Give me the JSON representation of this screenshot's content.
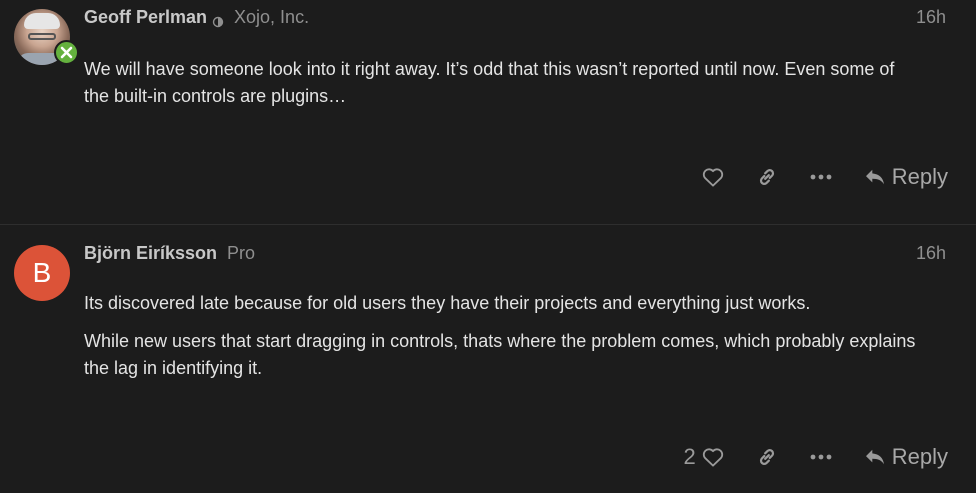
{
  "posts": [
    {
      "username": "Geoff Perlman",
      "user_title": "Xojo, Inc.",
      "timestamp": "16h",
      "avatar": {
        "type": "photo",
        "badge_icon": "xojo-x-icon",
        "badge_color": "#64b13e"
      },
      "paragraphs": [
        "We will have someone look into it right away. It’s odd that this wasn’t reported until now. Even some of the built-in controls are plugins…"
      ],
      "like_count": "",
      "reply_label": "Reply"
    },
    {
      "username": "Björn Eiríksson",
      "user_title": "Pro",
      "timestamp": "16h",
      "avatar": {
        "type": "letter",
        "letter": "B",
        "color": "#dc5338"
      },
      "paragraphs": [
        "Its discovered late because for old users they have their projects and everything just works.",
        "While new users that start dragging in controls, thats where the problem comes, which probably explains the lag in identifying it."
      ],
      "like_count": "2",
      "reply_label": "Reply"
    }
  ],
  "icons": {
    "like": "heart-icon",
    "link": "link-icon",
    "more": "ellipsis-icon",
    "reply": "reply-arrow-icon",
    "moderator": "shield-icon"
  },
  "colors": {
    "background": "#1c1c1c",
    "text": "#dddddd",
    "muted": "#8f8f8f"
  }
}
